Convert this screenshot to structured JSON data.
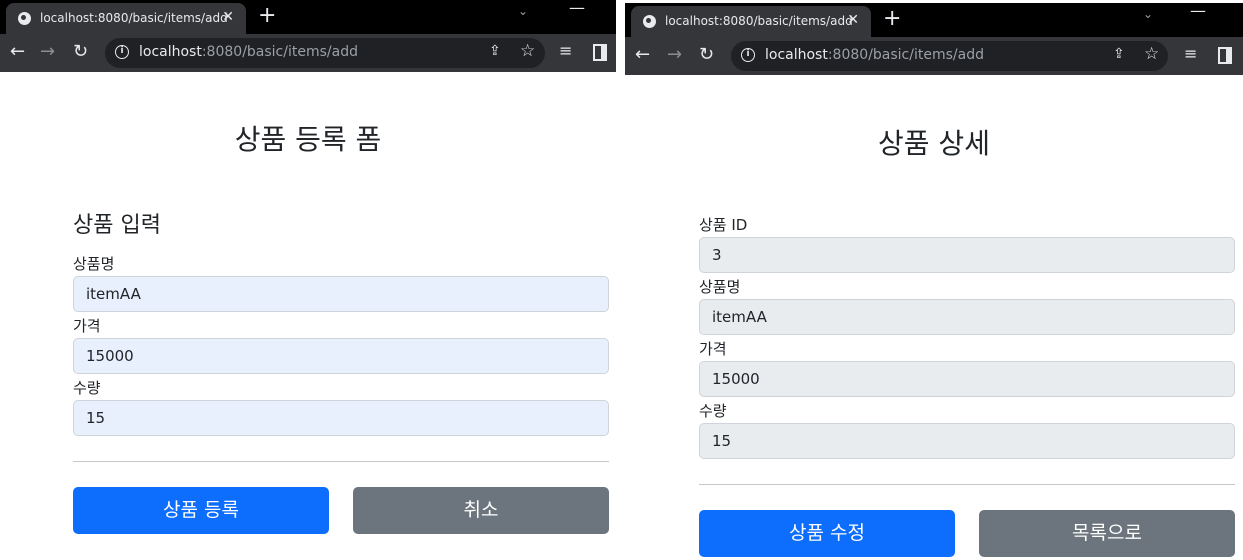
{
  "browser": {
    "tab_title": "localhost:8080/basic/items/add",
    "url_host": "localhost",
    "url_path": ":8080/basic/items/add",
    "new_tab_symbol": "+",
    "close_symbol": "✕"
  },
  "left": {
    "page_title": "상품 등록 폼",
    "section_title": "상품 입력",
    "fields": [
      {
        "label": "상품명",
        "value": "itemAA"
      },
      {
        "label": "가격",
        "value": "15000"
      },
      {
        "label": "수량",
        "value": "15"
      }
    ],
    "submit_label": "상품 등록",
    "cancel_label": "취소"
  },
  "right": {
    "page_title": "상품 상세",
    "fields": [
      {
        "label": "상품 ID",
        "value": "3"
      },
      {
        "label": "상품명",
        "value": "itemAA"
      },
      {
        "label": "가격",
        "value": "15000"
      },
      {
        "label": "수량",
        "value": "15"
      }
    ],
    "edit_label": "상품 수정",
    "list_label": "목록으로"
  },
  "colors": {
    "primary": "#0d6efd",
    "secondary": "#6c757d",
    "autofill_bg": "#e8f0fe",
    "readonly_bg": "#e9ecef"
  }
}
